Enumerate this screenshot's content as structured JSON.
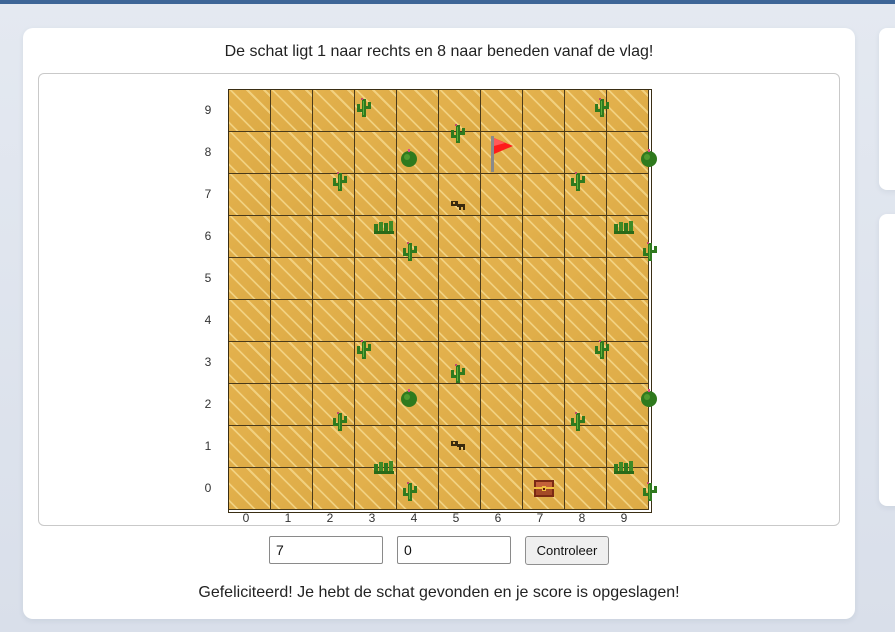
{
  "hint": "De schat ligt 1 naar rechts en 8 naar beneden vanaf de vlag!",
  "board": {
    "cols": 10,
    "rows": 10,
    "x_labels": [
      "0",
      "1",
      "2",
      "3",
      "4",
      "5",
      "6",
      "7",
      "8",
      "9"
    ],
    "y_labels": [
      "9",
      "8",
      "7",
      "6",
      "5",
      "4",
      "3",
      "2",
      "1",
      "0"
    ],
    "flag": {
      "col": 6,
      "row": 8
    },
    "treasure": {
      "col": 7,
      "row": 0
    }
  },
  "inputs": {
    "x_value": "7",
    "y_value": "0"
  },
  "check_button": "Controleer",
  "status_message": "Gefeliciteerd! Je hebt de schat gevonden en je score is opgeslagen!",
  "colors": {
    "sand": "#e0ad48",
    "grid_line": "#4a3a1a",
    "cactus": "#2f7a1e",
    "flag": "#ff1a1a",
    "topbar": "#3d6597"
  }
}
